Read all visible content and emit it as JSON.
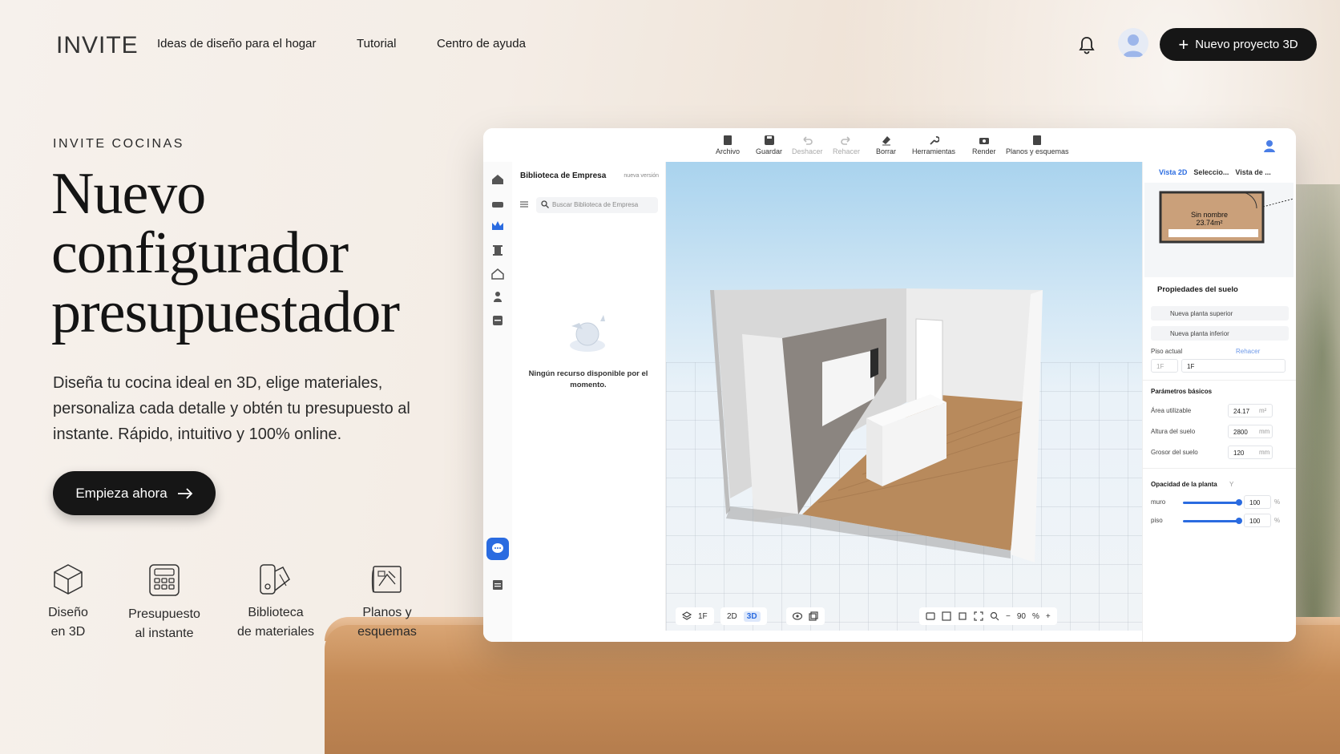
{
  "nav": {
    "logo": "INVITE",
    "links": [
      "Ideas de diseño para el hogar",
      "Tutorial",
      "Centro de ayuda"
    ],
    "new_project": "Nuevo proyecto 3D"
  },
  "hero": {
    "eyebrow": "INVITE COCINAS",
    "headline": [
      "Nuevo",
      "configurador",
      "presupuestador"
    ],
    "subtitle": "Diseña tu cocina ideal en 3D, elige materiales, personaliza cada detalle y obtén tu presupuesto al instante. Rápido, intuitivo y 100% online.",
    "cta": "Empieza ahora"
  },
  "features": [
    {
      "line1": "Diseño",
      "line2": "en 3D",
      "icon": "cube-icon"
    },
    {
      "line1": "Presupuesto",
      "line2": "al instante",
      "icon": "calculator-icon"
    },
    {
      "line1": "Biblioteca",
      "line2": "de materiales",
      "icon": "swatches-icon"
    },
    {
      "line1": "Planos y",
      "line2": "esquemas",
      "icon": "blueprint-icon"
    }
  ],
  "app": {
    "toolbar": [
      "Archivo",
      "Guardar",
      "Deshacer",
      "Rehacer",
      "Borrar",
      "Herramientas",
      "Render",
      "Planos y esquemas"
    ],
    "library": {
      "title": "Biblioteca de Empresa",
      "tag": "nueva versión",
      "search_placeholder": "Buscar Biblioteca de Empresa",
      "empty": "Ningún recurso disponible por el momento."
    },
    "viewport": {
      "floor": "1F",
      "mode_2d": "2D",
      "mode_3d": "3D",
      "zoom": "90",
      "zoom_unit": "%"
    },
    "panel": {
      "tabs": [
        "Vista 2D",
        "Seleccio...",
        "Vista de ..."
      ],
      "room_name": "Sin nombre",
      "room_area": "23.74m²",
      "props_title": "Propiedades del suelo",
      "upper": "Nueva planta superior",
      "lower": "Nueva planta inferior",
      "piso_actual": "Piso actual",
      "rehacer": "Rehacer",
      "floor_a": "1F",
      "floor_b": "1F",
      "basic_title": "Parámetros básicos",
      "area_label": "Área utilizable",
      "area_val": "24.17",
      "area_unit": "m²",
      "height_label": "Altura del suelo",
      "height_val": "2800",
      "height_unit": "mm",
      "thick_label": "Grosor del suelo",
      "thick_val": "120",
      "thick_unit": "mm",
      "opacity_title": "Opacidad de la planta",
      "opacity_tag": "Y",
      "muro_label": "muro",
      "muro_val": "100",
      "piso_label": "piso",
      "piso_val": "100",
      "pct": "%"
    }
  }
}
